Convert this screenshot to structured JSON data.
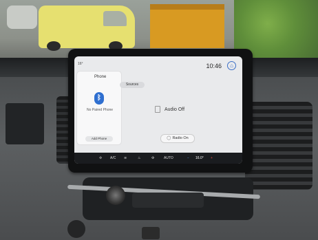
{
  "screen": {
    "status": {
      "left_label": "16°",
      "time": "10:46"
    },
    "phone_card": {
      "title": "Phone",
      "status_text": "No Paired Phone",
      "add_phone_label": "Add Phone"
    },
    "sources_label": "Sources",
    "audio_status": "Audio Off",
    "radio_on_label": "Radio On",
    "climate_bar": {
      "ac_label": "A/C",
      "auto_label": "AUTO",
      "temp_right": "16.0°",
      "minus": "−",
      "plus": "+"
    }
  },
  "icons": {
    "bluetooth": "bluetooth-icon",
    "home": "home-icon",
    "radio": "radio-icon",
    "fan": "fan-icon",
    "seat_heat": "seat-heat-icon",
    "defrost": "defrost-icon"
  },
  "colors": {
    "accent_blue": "#2f6fd0",
    "screen_bg": "#e9eaec",
    "climate_bg": "#1a1c1f",
    "temp_plus": "#d7453d"
  }
}
